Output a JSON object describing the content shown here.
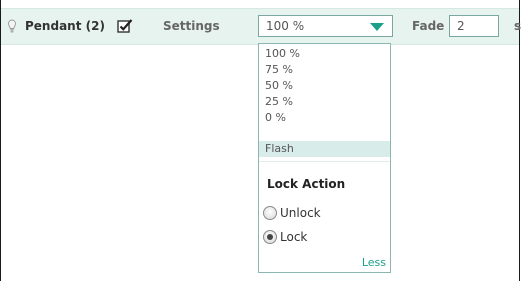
{
  "row": {
    "item_name": "Pendant (2)",
    "settings_label": "Settings",
    "selected_value": "100 %",
    "fade_label": "Fade",
    "fade_value": "2",
    "fade_unit": "s"
  },
  "menu": {
    "options": [
      "100 %",
      "75 %",
      "50 %",
      "25 %",
      "0 %",
      "Flash"
    ],
    "highlighted_option": "Flash",
    "lock_title": "Lock Action",
    "radios": [
      {
        "label": "Unlock",
        "checked": false
      },
      {
        "label": "Lock",
        "checked": true
      }
    ],
    "less_label": "Less"
  },
  "colors": {
    "accent": "#1aa089",
    "row_background": "#e6f3ef",
    "highlight": "#d8ecea"
  },
  "icons": {
    "bulb": "bulb-icon",
    "check": "checkbox-checked-icon",
    "arrow": "chevron-down-icon"
  }
}
